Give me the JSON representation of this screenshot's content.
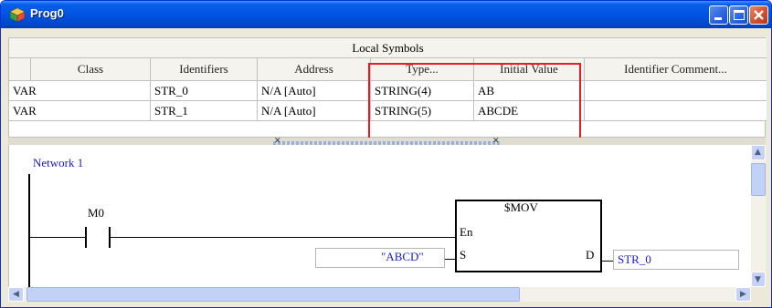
{
  "window": {
    "title": "Prog0",
    "colors": {
      "titlebar": "#0054e3",
      "highlight": "#e41e26",
      "symbol_text": "#1a1ad4"
    }
  },
  "symbols": {
    "section_title": "Local Symbols",
    "columns": [
      "Class",
      "Identifiers",
      "Address",
      "Type...",
      "Initial Value",
      "Identifier Comment..."
    ],
    "rows": [
      {
        "class": "VAR",
        "identifier": "STR_0",
        "address": "N/A [Auto]",
        "type": "STRING(4)",
        "initial_value": "AB",
        "comment": ""
      },
      {
        "class": "VAR",
        "identifier": "STR_1",
        "address": "N/A [Auto]",
        "type": "STRING(5)",
        "initial_value": "ABCDE",
        "comment": ""
      }
    ]
  },
  "ladder": {
    "network_label": "Network 1",
    "contact_label": "M0",
    "function_block": {
      "name": "$MOV",
      "pin_en": "En",
      "pin_s": "S",
      "pin_d": "D",
      "input_value": "\"ABCD\"",
      "output_value": "STR_0"
    }
  },
  "icons": {
    "app": "prog-cube-icon",
    "minimize": "minimize-icon",
    "maximize": "maximize-icon",
    "close": "close-icon"
  }
}
